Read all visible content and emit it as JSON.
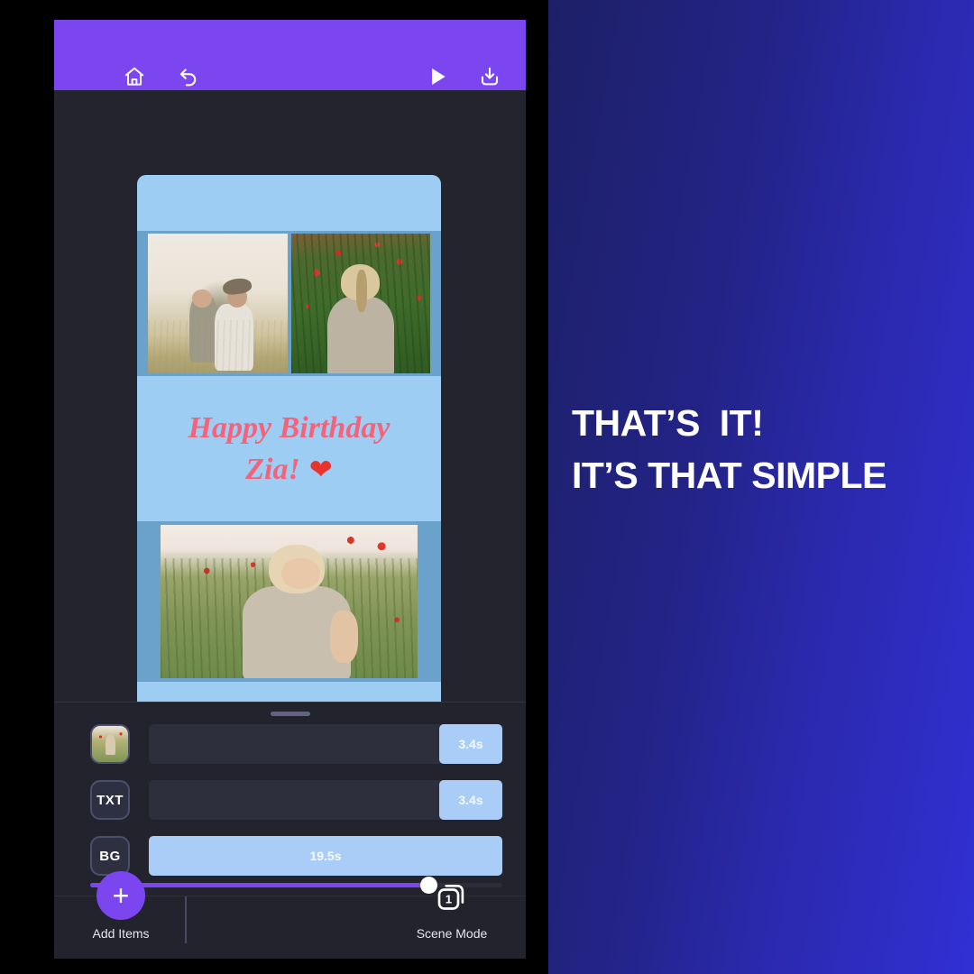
{
  "app": {
    "toolbar": {
      "home_icon": "home-icon",
      "undo_icon": "undo-icon",
      "play_icon": "play-icon",
      "download_icon": "download-icon",
      "more_icon": "more-options-icon",
      "accent_color": "#7b46f0"
    },
    "canvas": {
      "background_color": "#9dcdf2",
      "band_color": "#6ba2cb",
      "title_line1": "Happy Birthday",
      "title_line2": "Zia!",
      "title_emoji": "❤",
      "title_color": "#f4637a",
      "photos": [
        {
          "name": "photo-mother-and-toddler"
        },
        {
          "name": "photo-girl-in-poppies"
        },
        {
          "name": "photo-toddler-in-poppy-field"
        }
      ]
    },
    "duration": {
      "minus_label": "−",
      "value": "19.5 secs",
      "plus_label": "+"
    },
    "timeline": {
      "rows": [
        {
          "icon_label": "",
          "icon_kind": "thumbnail",
          "clip_label": "3.4s",
          "full": false
        },
        {
          "icon_label": "TXT",
          "icon_kind": "text",
          "clip_label": "3.4s",
          "full": false
        },
        {
          "icon_label": "BG",
          "icon_kind": "text",
          "clip_label": "19.5s",
          "full": true
        }
      ],
      "clip_color": "#a9cdf6",
      "scrubber_position_percent": 82,
      "scrubber_color": "#7b46f0"
    },
    "bottom_bar": {
      "add_items_label": "Add Items",
      "add_items_icon": "plus-icon",
      "scene_mode_label": "Scene Mode",
      "scene_mode_count": "1"
    }
  },
  "promo": {
    "line1": "THAT’S  IT!",
    "line2": "IT’S THAT SIMPLE",
    "gradient_from": "#1d2066",
    "gradient_to": "#3130d4",
    "text_color": "#ffffff"
  }
}
